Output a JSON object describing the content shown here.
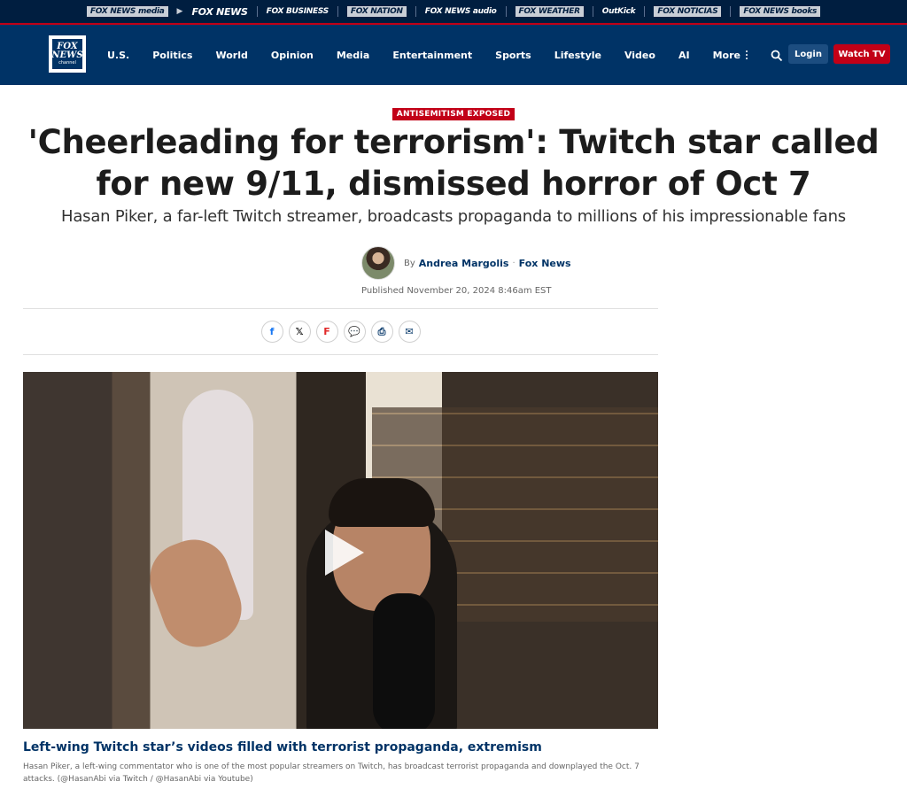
{
  "network": {
    "items": [
      "FOX NEWS media",
      "FOX NEWS",
      "FOX BUSINESS",
      "FOX NATION",
      "FOX NEWS audio",
      "FOX WEATHER",
      "OutKick",
      "FOX NOTICIAS",
      "FOX NEWS books"
    ]
  },
  "header": {
    "logo_line1": "FOX",
    "logo_line2": "NEWS",
    "logo_line3": "channel",
    "nav": [
      "U.S.",
      "Politics",
      "World",
      "Opinion",
      "Media",
      "Entertainment",
      "Sports",
      "Lifestyle",
      "Video",
      "AI"
    ],
    "more_label": "More",
    "login_label": "Login",
    "watch_label": "Watch TV"
  },
  "article": {
    "eyebrow": "ANTISEMITISM EXPOSED",
    "headline": "'Cheerleading for terrorism': Twitch star called for new 9/11, dismissed horror of Oct 7",
    "subhead": "Hasan Piker, a far-left Twitch streamer, broadcasts propaganda to millions of his impressionable fans",
    "by_label": "By",
    "author": "Andrea Margolis",
    "sep": "·",
    "outlet": "Fox News",
    "published": "Published November 20, 2024 8:46am EST"
  },
  "share": [
    "f",
    "𝕏",
    "F",
    "💬",
    "⎙",
    "✉"
  ],
  "video": {
    "caption_title": "Left-wing Twitch star’s videos filled with terrorist propaganda, extremism",
    "caption_text": "Hasan Piker, a left-wing commentator who is one of the most popular streamers on Twitch, has broadcast terrorist propaganda and downplayed the Oct. 7 attacks. (@HasanAbi via Twitch / @HasanAbi via Youtube)"
  }
}
